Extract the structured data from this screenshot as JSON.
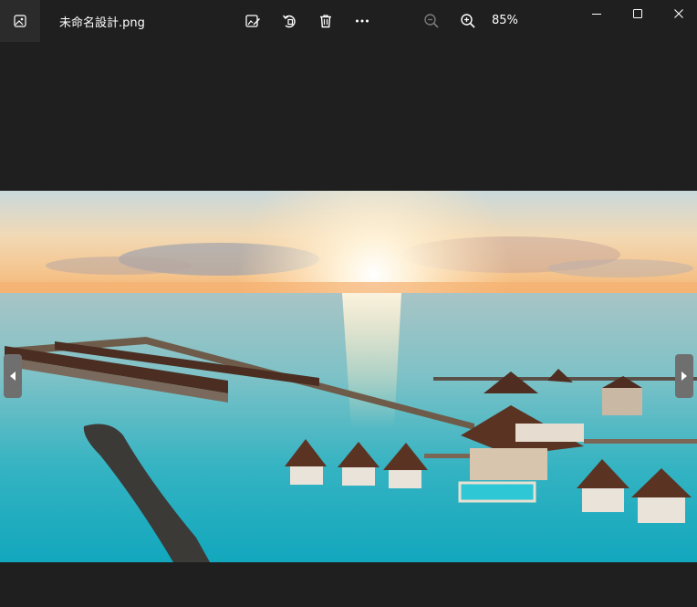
{
  "app": {
    "filename": "未命名設計.png",
    "zoom_level": "85%",
    "icons": {
      "app": "photo-icon",
      "edit": "edit-image-icon",
      "rotate": "rotate-icon",
      "delete": "trash-icon",
      "more": "more-icon",
      "zoom_out": "zoom-out-icon",
      "zoom_in": "zoom-in-icon",
      "minimize": "minimize-icon",
      "maximize": "maximize-icon",
      "close": "close-icon",
      "previous": "previous-arrow-icon",
      "next": "next-arrow-icon"
    }
  },
  "image": {
    "subject": "overwater-villas-sunset"
  },
  "colors": {
    "background": "#1f1f1f",
    "titlebar_icon_bg": "#2b2b2b",
    "icon": "#ffffff",
    "icon_disabled": "#7a7a7a",
    "nav_arrow_bg": "#6f6f6f"
  }
}
